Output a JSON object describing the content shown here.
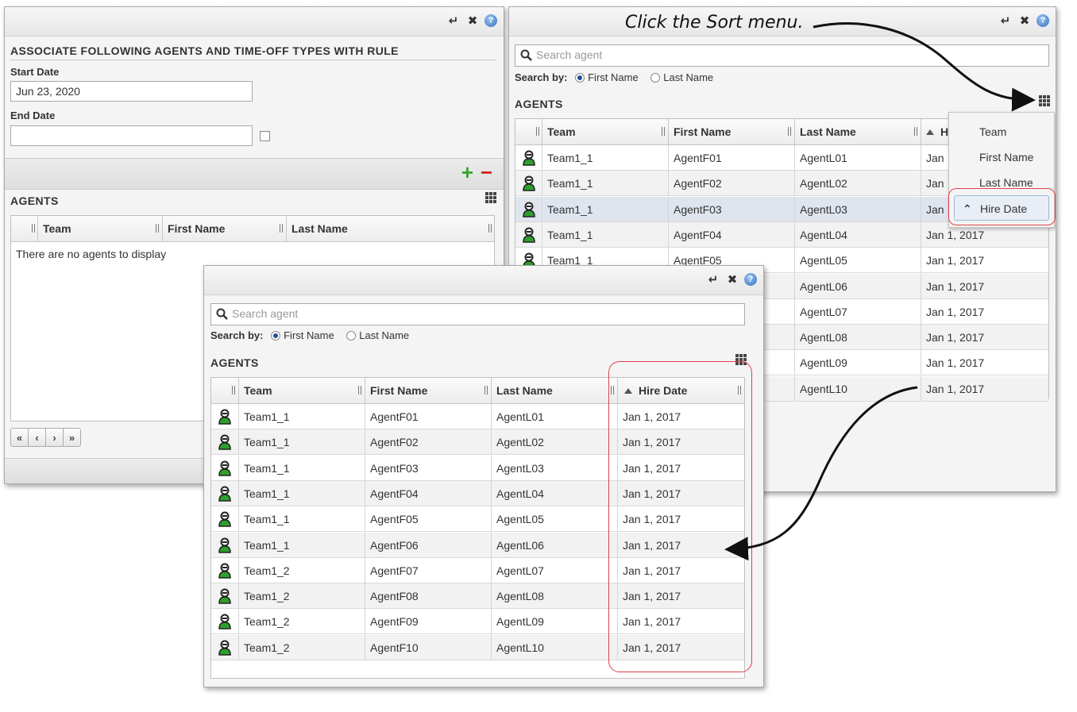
{
  "annotation": "Click the Sort menu.",
  "colors": {
    "callout": "#e0404a",
    "add": "#3aa335",
    "remove": "#d22222",
    "agent": "#2e9e2e"
  },
  "left_panel": {
    "section_title": "ASSOCIATE FOLLOWING AGENTS AND TIME-OFF TYPES WITH RULE",
    "start_date_label": "Start Date",
    "start_date_value": "Jun 23, 2020",
    "end_date_label": "End Date",
    "end_date_value": "",
    "agents_title": "AGENTS",
    "columns": [
      "Team",
      "First Name",
      "Last Name"
    ],
    "empty_message": "There are no agents to display",
    "pager": [
      "«",
      "‹",
      "›",
      "»"
    ]
  },
  "right_panel": {
    "search_placeholder": "Search agent",
    "search_by_label": "Search by:",
    "search_by_options": [
      "First Name",
      "Last Name"
    ],
    "agents_title": "AGENTS",
    "columns": [
      "Team",
      "First Name",
      "Last Name",
      "H"
    ],
    "rows": [
      {
        "team": "Team1_1",
        "first": "AgentF01",
        "last": "AgentL01",
        "hire": "Jan"
      },
      {
        "team": "Team1_1",
        "first": "AgentF02",
        "last": "AgentL02",
        "hire": "Jan"
      },
      {
        "team": "Team1_1",
        "first": "AgentF03",
        "last": "AgentL03",
        "hire": "Jan"
      },
      {
        "team": "Team1_1",
        "first": "AgentF04",
        "last": "AgentL04",
        "hire": "Jan 1, 2017"
      },
      {
        "team": "Team1_1",
        "first": "AgentF05",
        "last": "AgentL05",
        "hire": "Jan 1, 2017"
      },
      {
        "team": "",
        "first": "",
        "last": "AgentL06",
        "hire": "Jan 1, 2017"
      },
      {
        "team": "",
        "first": "",
        "last": "AgentL07",
        "hire": "Jan 1, 2017"
      },
      {
        "team": "",
        "first": "",
        "last": "AgentL08",
        "hire": "Jan 1, 2017"
      },
      {
        "team": "",
        "first": "",
        "last": "AgentL09",
        "hire": "Jan 1, 2017"
      },
      {
        "team": "",
        "first": "",
        "last": "AgentL10",
        "hire": "Jan 1, 2017"
      }
    ],
    "sort_menu": [
      "Team",
      "First Name",
      "Last Name",
      "Hire Date"
    ]
  },
  "front_panel": {
    "search_placeholder": "Search agent",
    "search_by_label": "Search by:",
    "search_by_options": [
      "First Name",
      "Last Name"
    ],
    "agents_title": "AGENTS",
    "columns": [
      "Team",
      "First Name",
      "Last Name",
      "Hire Date"
    ],
    "rows": [
      {
        "team": "Team1_1",
        "first": "AgentF01",
        "last": "AgentL01",
        "hire": "Jan 1, 2017"
      },
      {
        "team": "Team1_1",
        "first": "AgentF02",
        "last": "AgentL02",
        "hire": "Jan 1, 2017"
      },
      {
        "team": "Team1_1",
        "first": "AgentF03",
        "last": "AgentL03",
        "hire": "Jan 1, 2017"
      },
      {
        "team": "Team1_1",
        "first": "AgentF04",
        "last": "AgentL04",
        "hire": "Jan 1, 2017"
      },
      {
        "team": "Team1_1",
        "first": "AgentF05",
        "last": "AgentL05",
        "hire": "Jan 1, 2017"
      },
      {
        "team": "Team1_1",
        "first": "AgentF06",
        "last": "AgentL06",
        "hire": "Jan 1, 2017"
      },
      {
        "team": "Team1_2",
        "first": "AgentF07",
        "last": "AgentL07",
        "hire": "Jan 1, 2017"
      },
      {
        "team": "Team1_2",
        "first": "AgentF08",
        "last": "AgentL08",
        "hire": "Jan 1, 2017"
      },
      {
        "team": "Team1_2",
        "first": "AgentF09",
        "last": "AgentL09",
        "hire": "Jan 1, 2017"
      },
      {
        "team": "Team1_2",
        "first": "AgentF10",
        "last": "AgentL10",
        "hire": "Jan 1, 2017"
      }
    ]
  },
  "icons": {
    "enter": "↵",
    "close": "✖",
    "help": "?",
    "search": "search-icon",
    "grid": "grid-icon",
    "add": "+",
    "remove": "−"
  }
}
